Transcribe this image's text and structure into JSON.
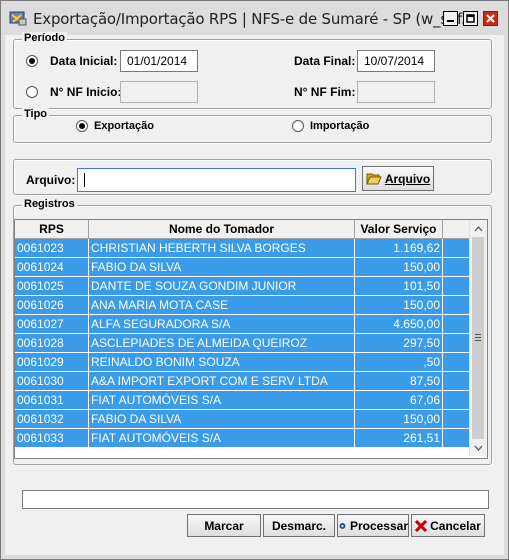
{
  "window": {
    "title": "Exportação/Importação RPS  |  NFS-e de Sumaré - SP (w_sef...",
    "minimize_icon": "minimize-icon",
    "maximize_icon": "maximize-icon",
    "close_icon": "close-icon"
  },
  "periodo": {
    "group_label": "Período",
    "mode_data_selected": true,
    "data_inicial_label": "Data Inicial:",
    "data_inicial_value": "01/01/2014",
    "data_final_label": "Data Final:",
    "data_final_value": "10/07/2014",
    "nf_inicio_label": "N° NF Inicio:",
    "nf_inicio_value": "",
    "nf_fim_label": "N° NF Fim:",
    "nf_fim_value": ""
  },
  "tipo": {
    "group_label": "Tipo",
    "exportacao_label": "Exportação",
    "importacao_label": "Importação",
    "selected": "Exportação"
  },
  "arquivo": {
    "label": "Arquivo:",
    "value": "",
    "button_label": "Arquivo",
    "button_icon": "folder-open-icon"
  },
  "registros": {
    "group_label": "Registros",
    "columns": [
      "RPS",
      "Nome do Tomador",
      "Valor Serviço"
    ],
    "rows": [
      {
        "rps": "0061023",
        "nome": "CHRISTIAN HEBERTH SILVA  BORGES",
        "valor": "1.169,62"
      },
      {
        "rps": "0061024",
        "nome": "FABIO DA SILVA",
        "valor": "150,00"
      },
      {
        "rps": "0061025",
        "nome": "DANTE DE SOUZA GONDIM JUNIOR",
        "valor": "101,50"
      },
      {
        "rps": "0061026",
        "nome": "ANA MARIA MOTA CASE",
        "valor": "150,00"
      },
      {
        "rps": "0061027",
        "nome": "ALFA SEGURADORA S/A",
        "valor": "4.650,00"
      },
      {
        "rps": "0061028",
        "nome": "ASCLEPIADES DE ALMEIDA QUEIROZ",
        "valor": "297,50"
      },
      {
        "rps": "0061029",
        "nome": "REINALDO BONIM SOUZA",
        "valor": ",50"
      },
      {
        "rps": "0061030",
        "nome": "A&A IMPORT EXPORT COM E SERV LTDA",
        "valor": "87,50"
      },
      {
        "rps": "0061031",
        "nome": "FIAT AUTOMÓVEIS S/A",
        "valor": "67,06"
      },
      {
        "rps": "0061032",
        "nome": "FABIO DA SILVA",
        "valor": "150,00"
      },
      {
        "rps": "0061033",
        "nome": "FIAT AUTOMÓVEIS S/A",
        "valor": "261,51"
      }
    ]
  },
  "status": {
    "text": ""
  },
  "buttons": {
    "marcar": "Marcar",
    "desmarcar": "Desmarc.",
    "processar": "Processar",
    "cancelar": "Cancelar"
  },
  "colors": {
    "row_selected": "#3a9be8",
    "close_button": "#c42b1c",
    "cancel_x": "#cc0000"
  }
}
